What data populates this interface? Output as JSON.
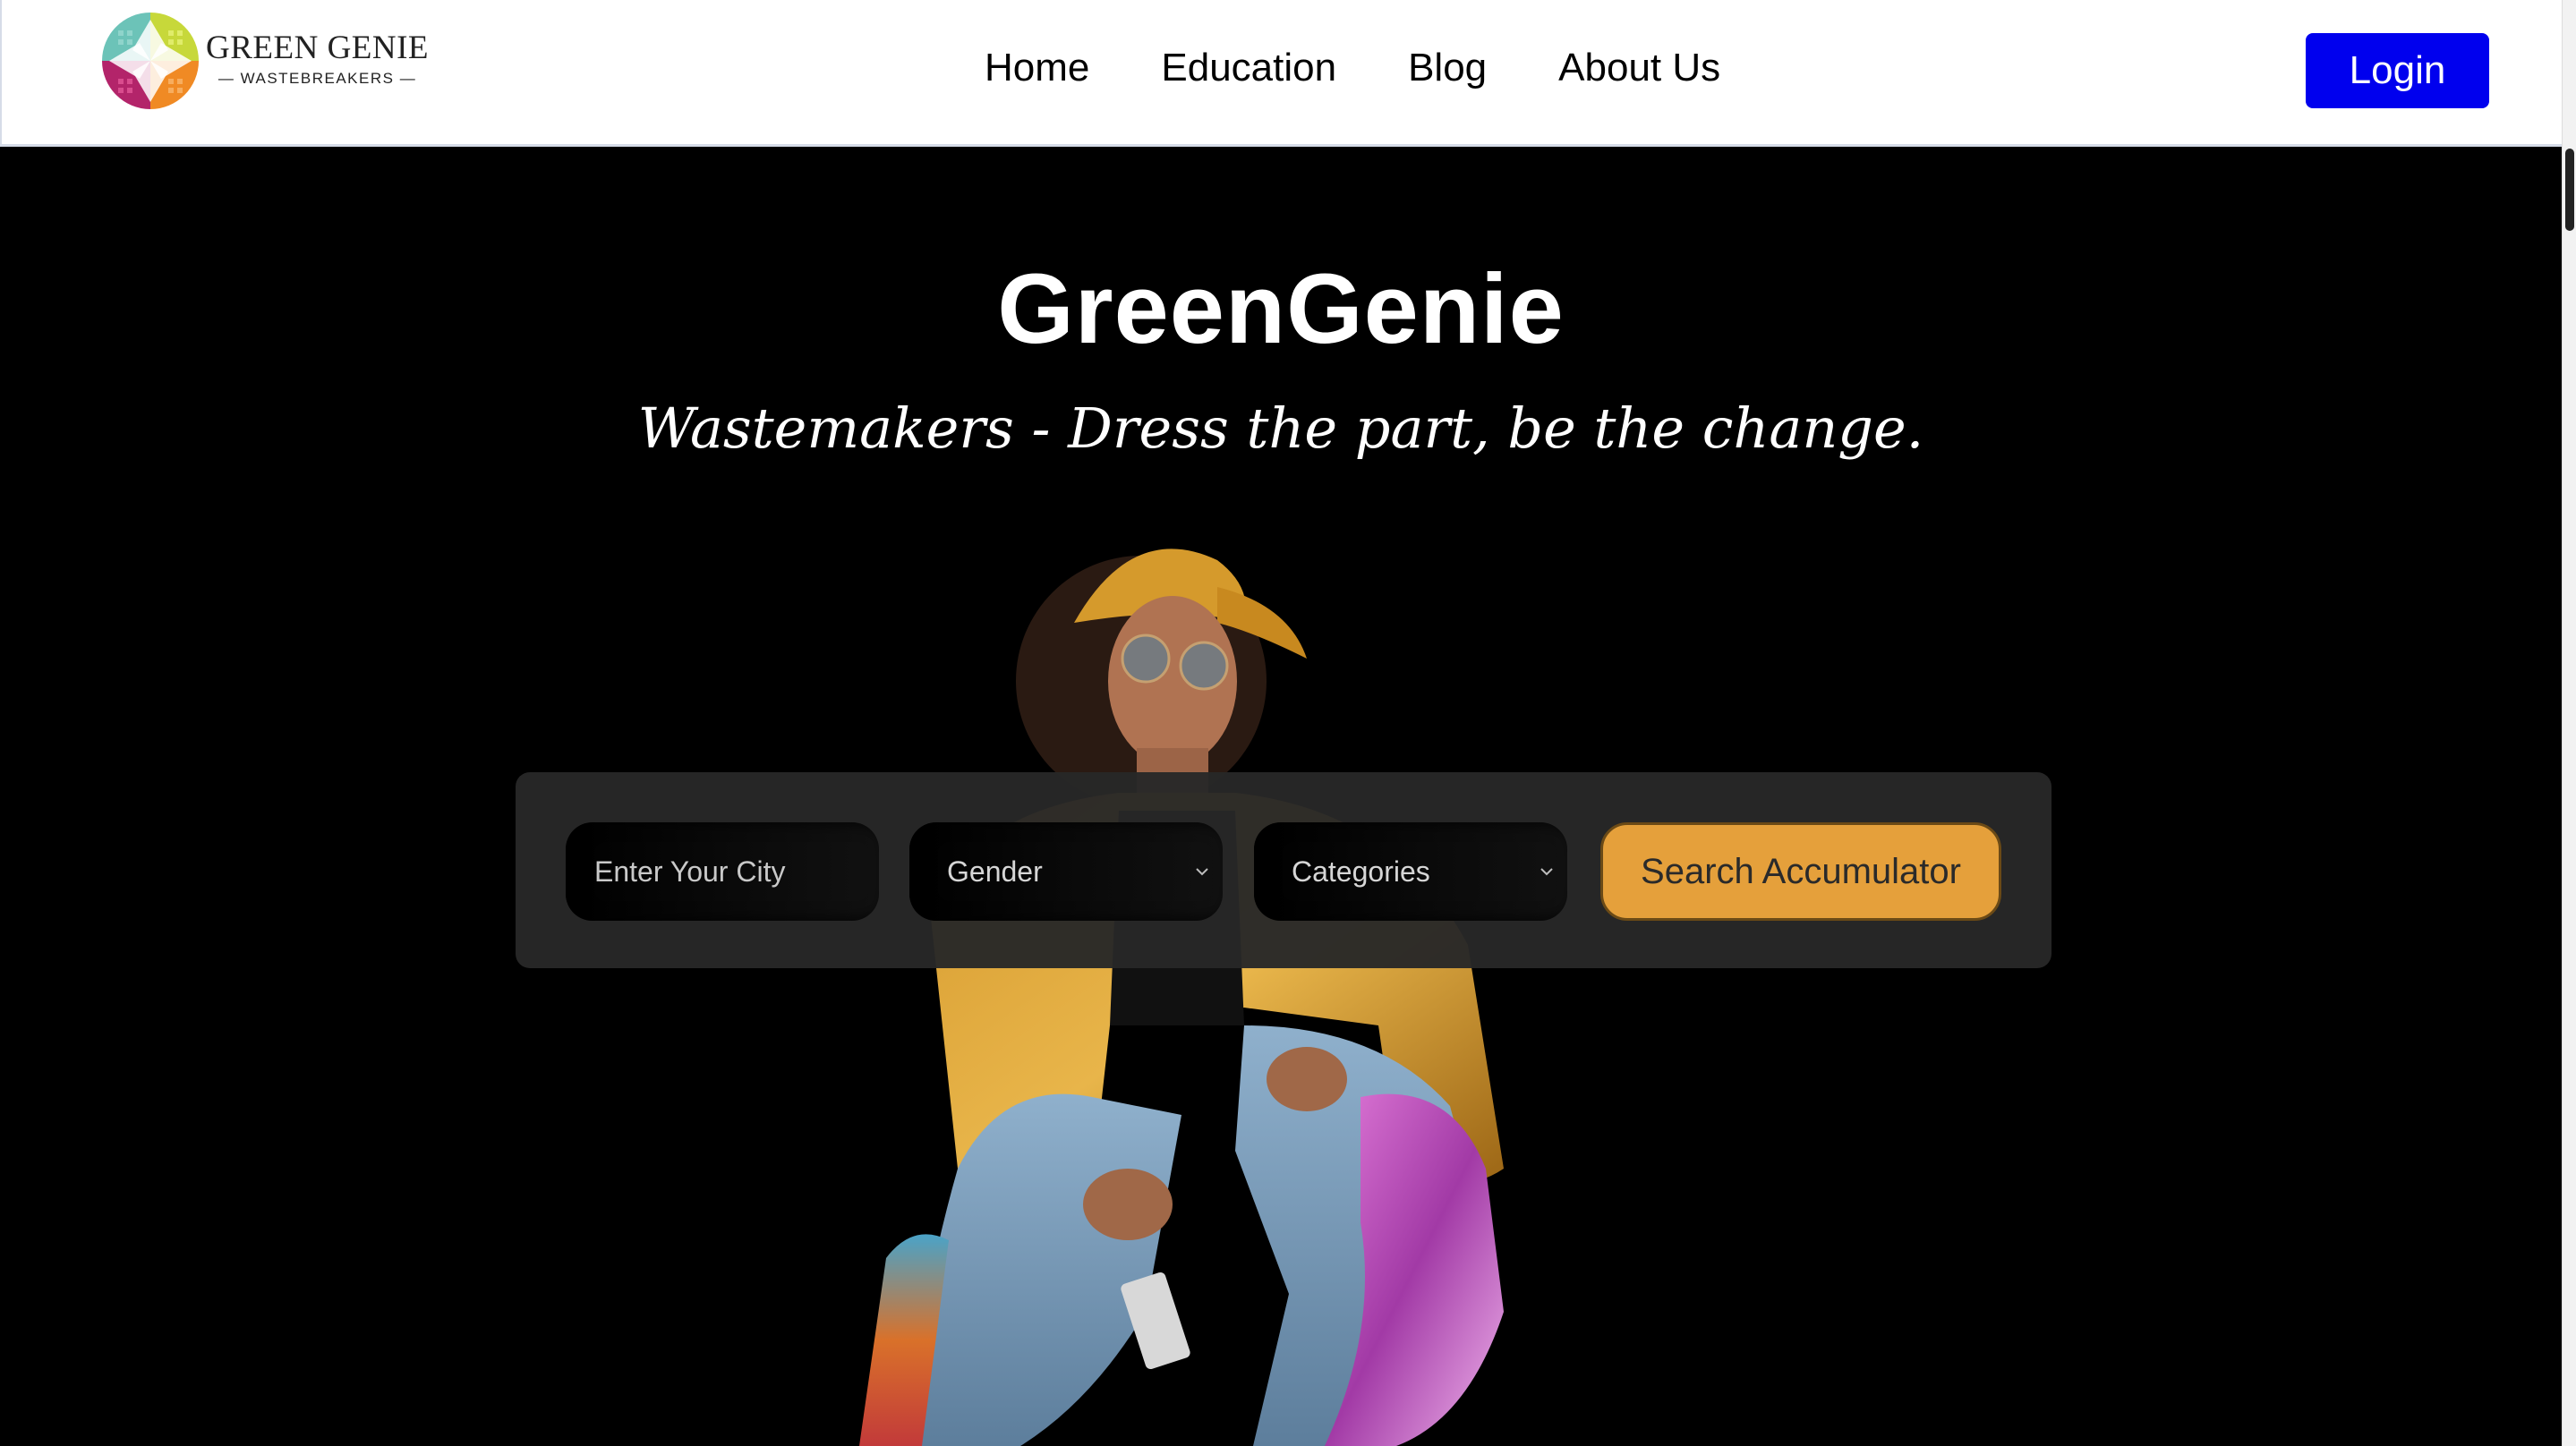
{
  "brand": {
    "name": "GREEN GENIE",
    "subtitle": "— WASTEBREAKERS —"
  },
  "nav": {
    "links": [
      "Home",
      "Education",
      "Blog",
      "About Us"
    ],
    "login_label": "Login"
  },
  "hero": {
    "title": "GreenGenie",
    "tagline": "Wastemakers - Dress the part, be the change."
  },
  "search": {
    "city_placeholder": "Enter Your City",
    "gender_selected": "Gender",
    "categories_selected": "Categories",
    "button_label": "Search Accumulator"
  },
  "colors": {
    "login_button": "#0000ee",
    "search_button": "#e5a03b",
    "hero_background": "#000000",
    "panel_background": "#282828"
  }
}
